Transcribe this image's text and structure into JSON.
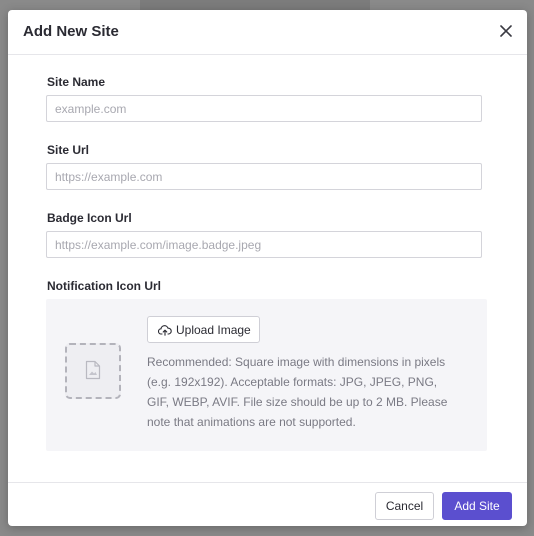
{
  "modal": {
    "title": "Add New Site",
    "close_icon": "close-icon"
  },
  "fields": {
    "site_name": {
      "label": "Site Name",
      "placeholder": "example.com",
      "value": ""
    },
    "site_url": {
      "label": "Site Url",
      "placeholder": "https://example.com",
      "value": ""
    },
    "badge_icon_url": {
      "label": "Badge Icon Url",
      "placeholder": "https://example.com/image.badge.jpeg",
      "value": ""
    },
    "notification_icon_url": {
      "label": "Notification Icon Url"
    }
  },
  "upload": {
    "button_label": "Upload Image",
    "button_icon": "cloud-upload-icon",
    "placeholder_icon": "image-file-icon",
    "help_text": "Recommended: Square image with dimensions in pixels (e.g. 192x192). Acceptable formats: JPG, JPEG, PNG, GIF, WEBP, AVIF. File size should be up to 2 MB. Please note that animations are not supported."
  },
  "footer": {
    "cancel_label": "Cancel",
    "submit_label": "Add Site"
  },
  "colors": {
    "primary": "#5b4fcf",
    "overlay": "#8a8a8a",
    "panel": "#f5f5f8"
  }
}
